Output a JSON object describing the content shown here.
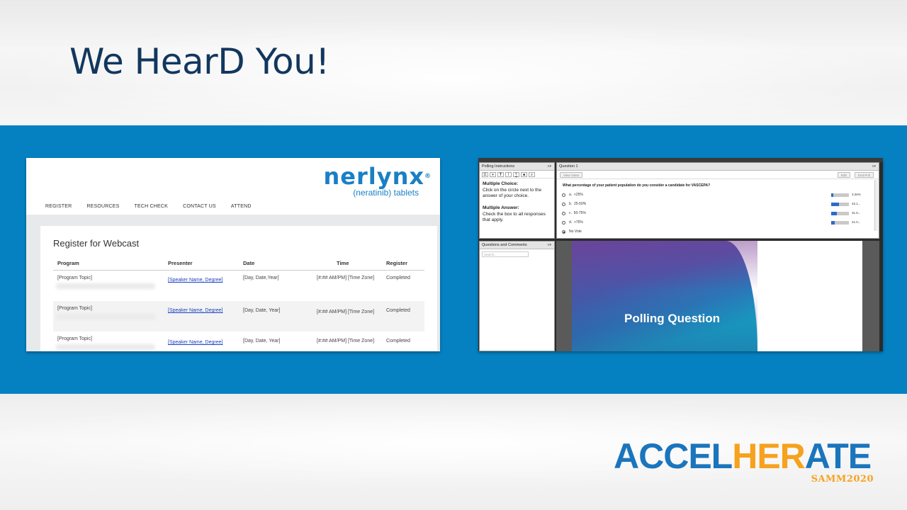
{
  "slide": {
    "title": "We HearD You!"
  },
  "left_screenshot": {
    "brand": {
      "name": "nerlynx",
      "registered": "®",
      "subtitle": "(neratinib) tablets"
    },
    "nav": [
      "REGISTER",
      "RESOURCES",
      "TECH CHECK",
      "CONTACT US",
      "ATTEND"
    ],
    "panel_title": "Register for Webcast",
    "columns": [
      "Program",
      "Presenter",
      "Date",
      "Time",
      "Register"
    ],
    "rows": [
      {
        "program": "[Program Topic]",
        "presenter": "[Speaker Name, Degree]",
        "date": "[Day, Date,Year]",
        "time": "[#:## AM/PM] [Time Zone]",
        "register": "Completed"
      },
      {
        "program": "[Program Topic]",
        "presenter": "[Speaker Name, Degree]",
        "date": "[Day, Date, Year]",
        "time": "[#:## AM/PM] [Time Zone]",
        "register": "Completed"
      },
      {
        "program": "[Program Topic]",
        "presenter": "[Speaker Name, Degree]",
        "date": "[Day, Date, Year]",
        "time": "[#:## AM/PM] [Time Zone]",
        "register": "Completed"
      }
    ]
  },
  "right_screenshot": {
    "instructions_pod": {
      "title": "Polling Instructions",
      "format_buttons": [
        "11",
        "▾",
        "T",
        "I",
        "T",
        "■",
        "≡"
      ],
      "mc_heading": "Multiple Choice:",
      "mc_text": "Click on the circle next to the answer of your choice.",
      "ma_heading": "Multiple Answer:",
      "ma_text": "Check the box to all responses that apply."
    },
    "question_pod": {
      "title": "Question 1",
      "view_votes": "View Votes",
      "edit": "Edit",
      "end_poll": "End Poll",
      "question": "What percentage of your patient population do you consider a candidate for VASCEPA?",
      "options": [
        {
          "letter": "a.",
          "label": "<25%",
          "percent": "3.26%",
          "fill": 0.1
        },
        {
          "letter": "b.",
          "label": "25-50%",
          "percent": "42.1...",
          "fill": 0.42
        },
        {
          "letter": "c.",
          "label": "50-75%",
          "percent": "31.5...",
          "fill": 0.32
        },
        {
          "letter": "d.",
          "label": ">75%",
          "percent": "21.0...",
          "fill": 0.21
        }
      ],
      "no_vote": "No Vote"
    },
    "qa_pod": {
      "title": "Questions and Comments",
      "search_placeholder": "Search..."
    },
    "share_pod": {
      "slide_text": "Polling Question"
    }
  },
  "logo": {
    "part1": "ACCEL",
    "part2": "HER",
    "part3": "ATE",
    "sub": "SAMM2020"
  },
  "colors": {
    "title": "#12375e",
    "band": "#0581c2",
    "logo_blue": "#1b75bc",
    "logo_orange": "#f6a21e"
  }
}
